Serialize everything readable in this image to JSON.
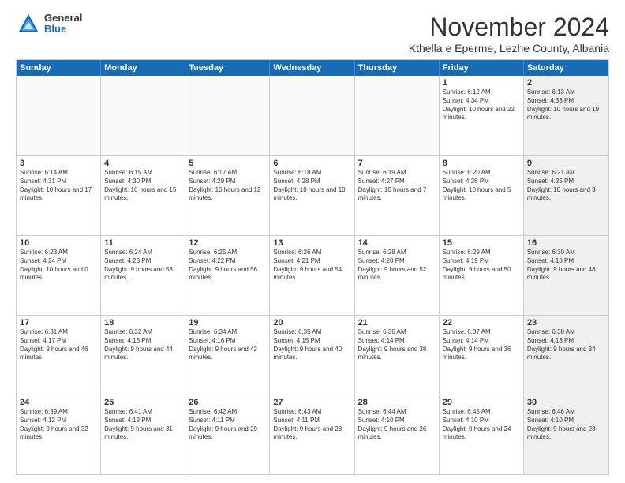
{
  "logo": {
    "general": "General",
    "blue": "Blue"
  },
  "title": "November 2024",
  "subtitle": "Kthella e Eperme, Lezhe County, Albania",
  "header_days": [
    "Sunday",
    "Monday",
    "Tuesday",
    "Wednesday",
    "Thursday",
    "Friday",
    "Saturday"
  ],
  "weeks": [
    [
      {
        "day": "",
        "text": "",
        "empty": true
      },
      {
        "day": "",
        "text": "",
        "empty": true
      },
      {
        "day": "",
        "text": "",
        "empty": true
      },
      {
        "day": "",
        "text": "",
        "empty": true
      },
      {
        "day": "",
        "text": "",
        "empty": true
      },
      {
        "day": "1",
        "text": "Sunrise: 6:12 AM\nSunset: 4:34 PM\nDaylight: 10 hours and 22 minutes.",
        "empty": false,
        "shaded": false
      },
      {
        "day": "2",
        "text": "Sunrise: 6:13 AM\nSunset: 4:33 PM\nDaylight: 10 hours and 19 minutes.",
        "empty": false,
        "shaded": true
      }
    ],
    [
      {
        "day": "3",
        "text": "Sunrise: 6:14 AM\nSunset: 4:31 PM\nDaylight: 10 hours and 17 minutes.",
        "empty": false,
        "shaded": false
      },
      {
        "day": "4",
        "text": "Sunrise: 6:15 AM\nSunset: 4:30 PM\nDaylight: 10 hours and 15 minutes.",
        "empty": false,
        "shaded": false
      },
      {
        "day": "5",
        "text": "Sunrise: 6:17 AM\nSunset: 4:29 PM\nDaylight: 10 hours and 12 minutes.",
        "empty": false,
        "shaded": false
      },
      {
        "day": "6",
        "text": "Sunrise: 6:18 AM\nSunset: 4:28 PM\nDaylight: 10 hours and 10 minutes.",
        "empty": false,
        "shaded": false
      },
      {
        "day": "7",
        "text": "Sunrise: 6:19 AM\nSunset: 4:27 PM\nDaylight: 10 hours and 7 minutes.",
        "empty": false,
        "shaded": false
      },
      {
        "day": "8",
        "text": "Sunrise: 6:20 AM\nSunset: 4:26 PM\nDaylight: 10 hours and 5 minutes.",
        "empty": false,
        "shaded": false
      },
      {
        "day": "9",
        "text": "Sunrise: 6:21 AM\nSunset: 4:25 PM\nDaylight: 10 hours and 3 minutes.",
        "empty": false,
        "shaded": true
      }
    ],
    [
      {
        "day": "10",
        "text": "Sunrise: 6:23 AM\nSunset: 4:24 PM\nDaylight: 10 hours and 0 minutes.",
        "empty": false,
        "shaded": false
      },
      {
        "day": "11",
        "text": "Sunrise: 6:24 AM\nSunset: 4:23 PM\nDaylight: 9 hours and 58 minutes.",
        "empty": false,
        "shaded": false
      },
      {
        "day": "12",
        "text": "Sunrise: 6:25 AM\nSunset: 4:22 PM\nDaylight: 9 hours and 56 minutes.",
        "empty": false,
        "shaded": false
      },
      {
        "day": "13",
        "text": "Sunrise: 6:26 AM\nSunset: 4:21 PM\nDaylight: 9 hours and 54 minutes.",
        "empty": false,
        "shaded": false
      },
      {
        "day": "14",
        "text": "Sunrise: 6:28 AM\nSunset: 4:20 PM\nDaylight: 9 hours and 52 minutes.",
        "empty": false,
        "shaded": false
      },
      {
        "day": "15",
        "text": "Sunrise: 6:29 AM\nSunset: 4:19 PM\nDaylight: 9 hours and 50 minutes.",
        "empty": false,
        "shaded": false
      },
      {
        "day": "16",
        "text": "Sunrise: 6:30 AM\nSunset: 4:18 PM\nDaylight: 9 hours and 48 minutes.",
        "empty": false,
        "shaded": true
      }
    ],
    [
      {
        "day": "17",
        "text": "Sunrise: 6:31 AM\nSunset: 4:17 PM\nDaylight: 9 hours and 46 minutes.",
        "empty": false,
        "shaded": false
      },
      {
        "day": "18",
        "text": "Sunrise: 6:32 AM\nSunset: 4:16 PM\nDaylight: 9 hours and 44 minutes.",
        "empty": false,
        "shaded": false
      },
      {
        "day": "19",
        "text": "Sunrise: 6:34 AM\nSunset: 4:16 PM\nDaylight: 9 hours and 42 minutes.",
        "empty": false,
        "shaded": false
      },
      {
        "day": "20",
        "text": "Sunrise: 6:35 AM\nSunset: 4:15 PM\nDaylight: 9 hours and 40 minutes.",
        "empty": false,
        "shaded": false
      },
      {
        "day": "21",
        "text": "Sunrise: 6:36 AM\nSunset: 4:14 PM\nDaylight: 9 hours and 38 minutes.",
        "empty": false,
        "shaded": false
      },
      {
        "day": "22",
        "text": "Sunrise: 6:37 AM\nSunset: 4:14 PM\nDaylight: 9 hours and 36 minutes.",
        "empty": false,
        "shaded": false
      },
      {
        "day": "23",
        "text": "Sunrise: 6:38 AM\nSunset: 4:13 PM\nDaylight: 9 hours and 34 minutes.",
        "empty": false,
        "shaded": true
      }
    ],
    [
      {
        "day": "24",
        "text": "Sunrise: 6:39 AM\nSunset: 4:12 PM\nDaylight: 9 hours and 32 minutes.",
        "empty": false,
        "shaded": false
      },
      {
        "day": "25",
        "text": "Sunrise: 6:41 AM\nSunset: 4:12 PM\nDaylight: 9 hours and 31 minutes.",
        "empty": false,
        "shaded": false
      },
      {
        "day": "26",
        "text": "Sunrise: 6:42 AM\nSunset: 4:11 PM\nDaylight: 9 hours and 29 minutes.",
        "empty": false,
        "shaded": false
      },
      {
        "day": "27",
        "text": "Sunrise: 6:43 AM\nSunset: 4:11 PM\nDaylight: 9 hours and 28 minutes.",
        "empty": false,
        "shaded": false
      },
      {
        "day": "28",
        "text": "Sunrise: 6:44 AM\nSunset: 4:10 PM\nDaylight: 9 hours and 26 minutes.",
        "empty": false,
        "shaded": false
      },
      {
        "day": "29",
        "text": "Sunrise: 6:45 AM\nSunset: 4:10 PM\nDaylight: 9 hours and 24 minutes.",
        "empty": false,
        "shaded": false
      },
      {
        "day": "30",
        "text": "Sunrise: 6:46 AM\nSunset: 4:10 PM\nDaylight: 9 hours and 23 minutes.",
        "empty": false,
        "shaded": true
      }
    ]
  ]
}
